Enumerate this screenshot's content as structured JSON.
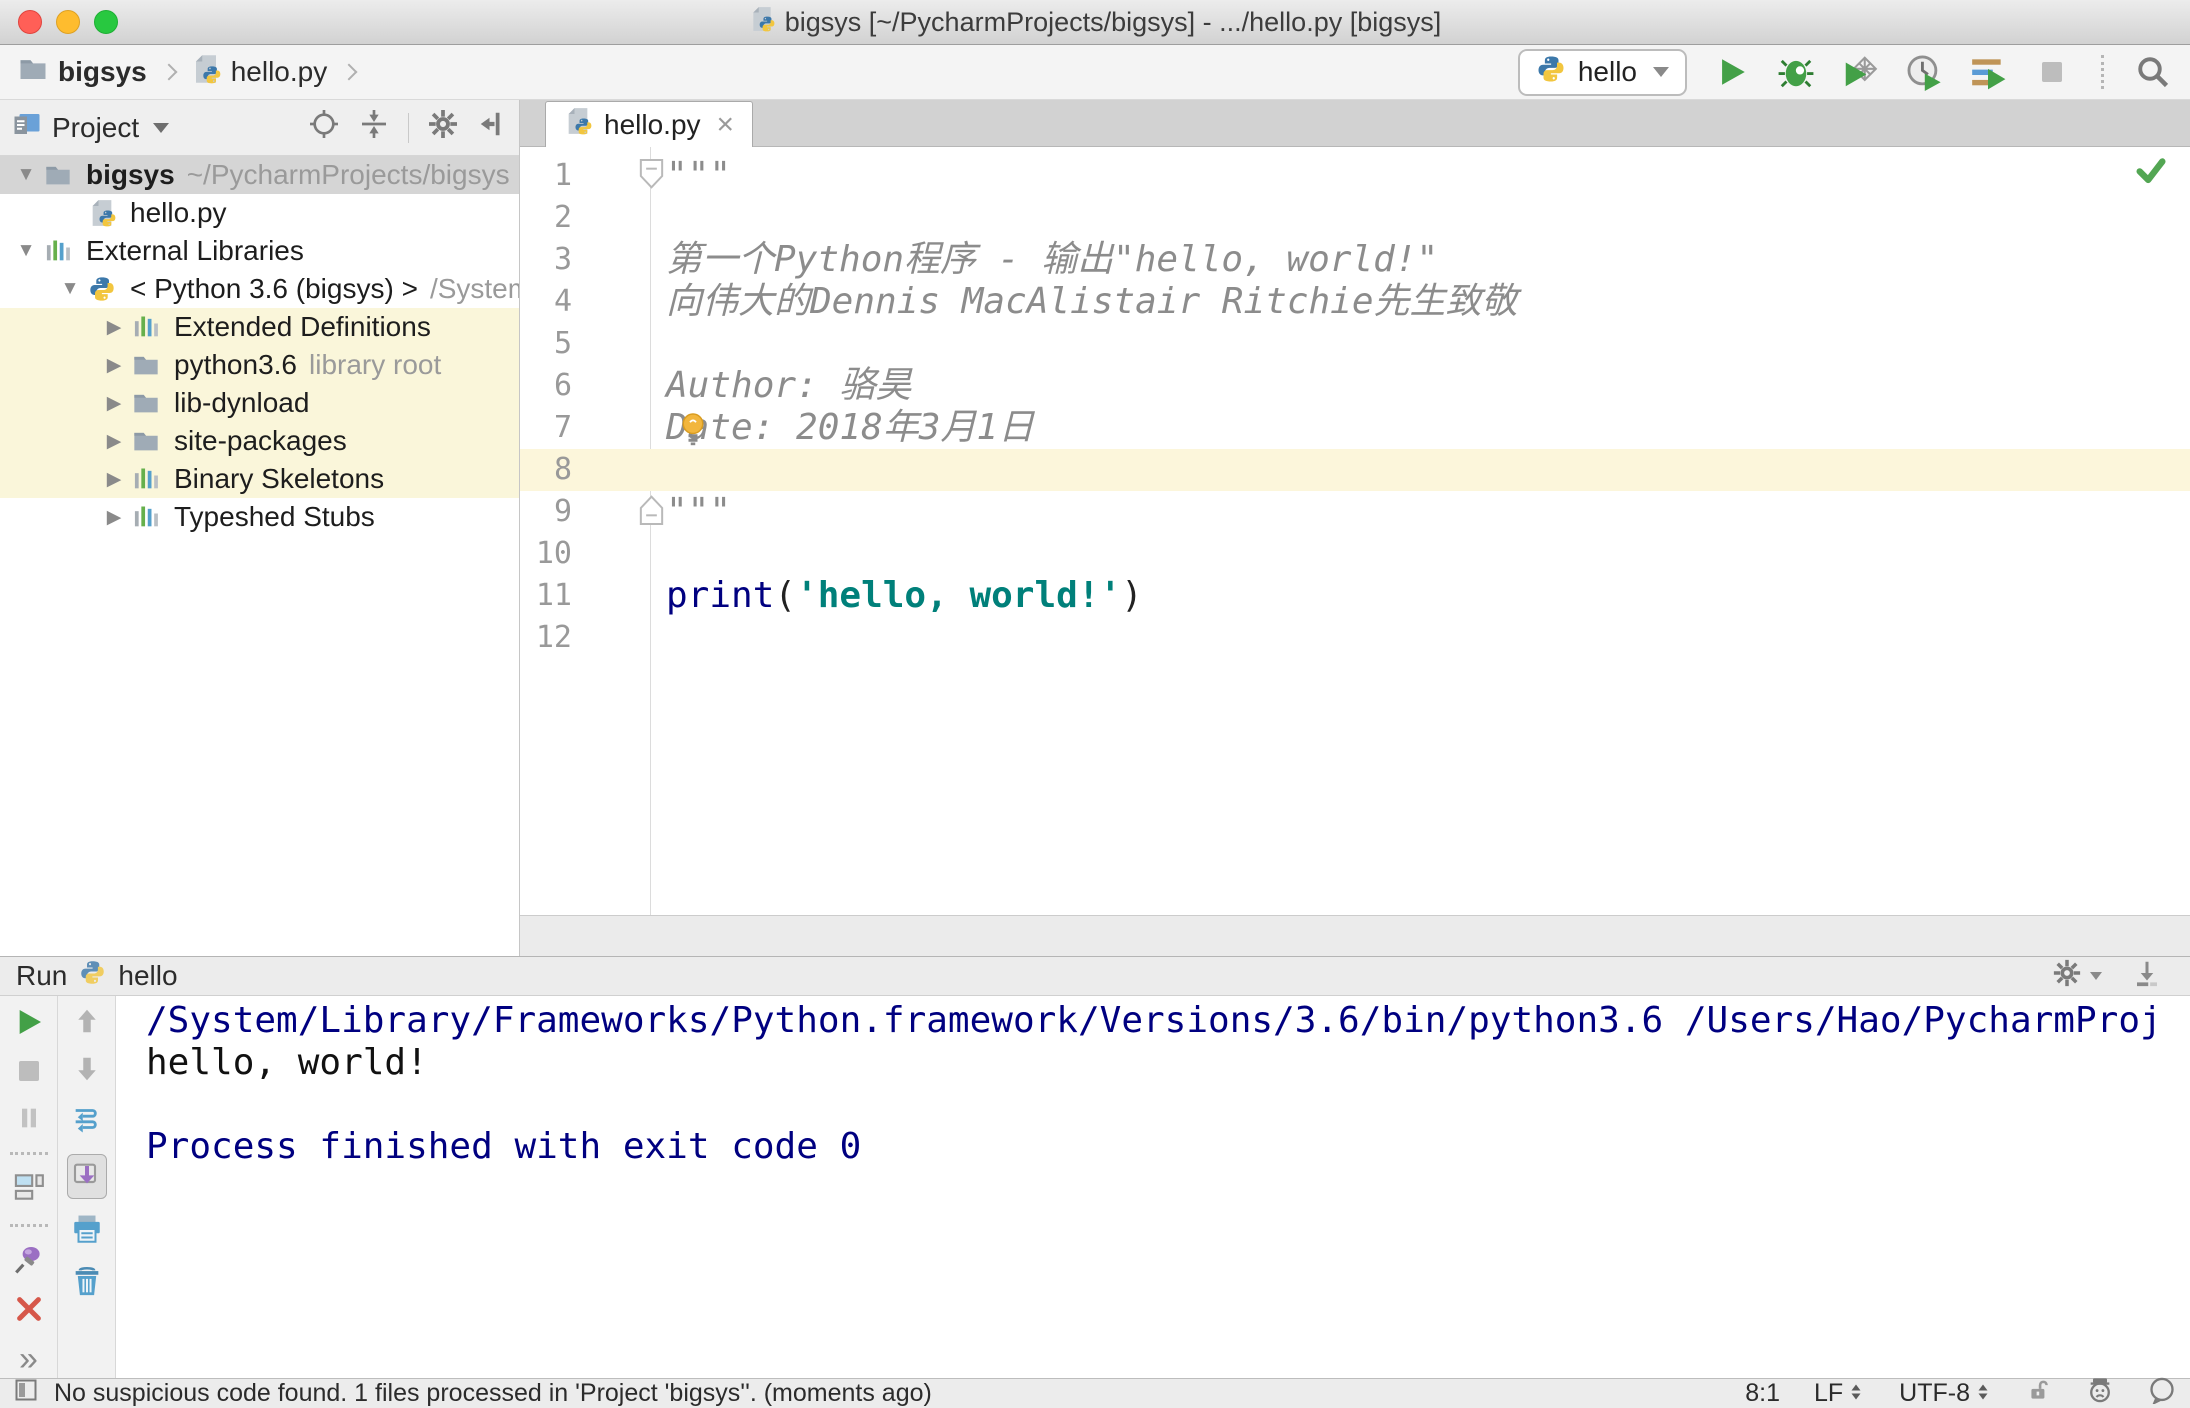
{
  "titlebar": {
    "title": "bigsys [~/PycharmProjects/bigsys] - .../hello.py [bigsys]"
  },
  "toolbar": {
    "breadcrumb": [
      {
        "label": "bigsys",
        "icon": "folder"
      },
      {
        "label": "hello.py",
        "icon": "python-file"
      }
    ],
    "run_config": "hello",
    "buttons": [
      "run",
      "debug",
      "run-with-coverage",
      "profiler",
      "concurrency-diagram",
      "stop",
      "search"
    ]
  },
  "project_panel": {
    "title": "Project",
    "header_buttons": [
      "locate",
      "collapse-all",
      "settings",
      "hide"
    ],
    "tree": [
      {
        "label": "bigsys",
        "secondary": "~/PycharmProjects/bigsys",
        "icon": "folder",
        "arrow": "down",
        "indent": 0,
        "selected": true,
        "bold": true
      },
      {
        "label": "hello.py",
        "secondary": "",
        "icon": "python-file",
        "arrow": "",
        "indent": 1
      },
      {
        "label": "External Libraries",
        "secondary": "",
        "icon": "library",
        "arrow": "down",
        "indent": 0
      },
      {
        "label": "< Python 3.6 (bigsys) >",
        "secondary": "/System",
        "icon": "python",
        "arrow": "down",
        "indent": 1
      },
      {
        "label": "Extended Definitions",
        "secondary": "",
        "icon": "library",
        "arrow": "right",
        "indent": 2,
        "highlight": true
      },
      {
        "label": "python3.6",
        "secondary": "library root",
        "icon": "folder",
        "arrow": "right",
        "indent": 2,
        "highlight": true
      },
      {
        "label": "lib-dynload",
        "secondary": "",
        "icon": "folder",
        "arrow": "right",
        "indent": 2,
        "highlight": true
      },
      {
        "label": "site-packages",
        "secondary": "",
        "icon": "folder",
        "arrow": "right",
        "indent": 2,
        "highlight": true
      },
      {
        "label": "Binary Skeletons",
        "secondary": "",
        "icon": "library",
        "arrow": "right",
        "indent": 2,
        "highlight": true
      },
      {
        "label": "Typeshed Stubs",
        "secondary": "",
        "icon": "library",
        "arrow": "right",
        "indent": 2
      }
    ]
  },
  "editor": {
    "tab": {
      "label": "hello.py"
    },
    "lines": [
      {
        "n": 1,
        "segments": [
          {
            "t": "\"\"\"",
            "c": "doc"
          }
        ],
        "fold": "start"
      },
      {
        "n": 2,
        "segments": []
      },
      {
        "n": 3,
        "segments": [
          {
            "t": "第一个Python程序 - 输出\"hello, world!\"",
            "c": "doc"
          }
        ]
      },
      {
        "n": 4,
        "segments": [
          {
            "t": "向伟大的Dennis MacAlistair Ritchie先生致敬",
            "c": "doc"
          }
        ]
      },
      {
        "n": 5,
        "segments": []
      },
      {
        "n": 6,
        "segments": [
          {
            "t": "Author: 骆昊",
            "c": "doc"
          }
        ]
      },
      {
        "n": 7,
        "segments": [
          {
            "t": "Date: 2018年3月1日",
            "c": "doc"
          }
        ],
        "bulb": true
      },
      {
        "n": 8,
        "segments": [],
        "current": true
      },
      {
        "n": 9,
        "segments": [
          {
            "t": "\"\"\"",
            "c": "doc"
          }
        ],
        "fold": "end"
      },
      {
        "n": 10,
        "segments": []
      },
      {
        "n": 11,
        "segments": [
          {
            "t": "print",
            "c": "kw"
          },
          {
            "t": "(",
            "c": "pl"
          },
          {
            "t": "'hello, world!'",
            "c": "str"
          },
          {
            "t": ")",
            "c": "pl"
          }
        ]
      },
      {
        "n": 12,
        "segments": []
      }
    ]
  },
  "run_panel": {
    "tab_label": "Run",
    "config_name": "hello",
    "left_buttons": [
      "rerun",
      "stop",
      "pause",
      "restore-layout",
      "pin",
      "close"
    ],
    "right_buttons": [
      "prev-occurrence",
      "next-occurrence",
      "soft-wrap",
      "scroll-to-end",
      "print",
      "clear-all"
    ],
    "console": [
      {
        "text": "/System/Library/Frameworks/Python.framework/Versions/3.6/bin/python3.6 /Users/Hao/PycharmProj",
        "kind": "system"
      },
      {
        "text": "hello, world!",
        "kind": "stdout"
      },
      {
        "text": "",
        "kind": "stdout"
      },
      {
        "text": "Process finished with exit code 0",
        "kind": "system"
      }
    ]
  },
  "status_bar": {
    "message": "No suspicious code found. 1 files processed in 'Project 'bigsys''. (moments ago)",
    "caret": "8:1",
    "line_ending": "LF",
    "encoding": "UTF-8"
  },
  "colors": {
    "selection_bg": "#d5d5d5",
    "library_highlight_bg": "#faf6da",
    "caret_row_bg": "#fcf6db",
    "keyword": "#000080",
    "string": "#00807a",
    "docstring": "#8c8c8c",
    "console_system": "#000080",
    "run_green": "#43a047",
    "check_green": "#53a653"
  }
}
